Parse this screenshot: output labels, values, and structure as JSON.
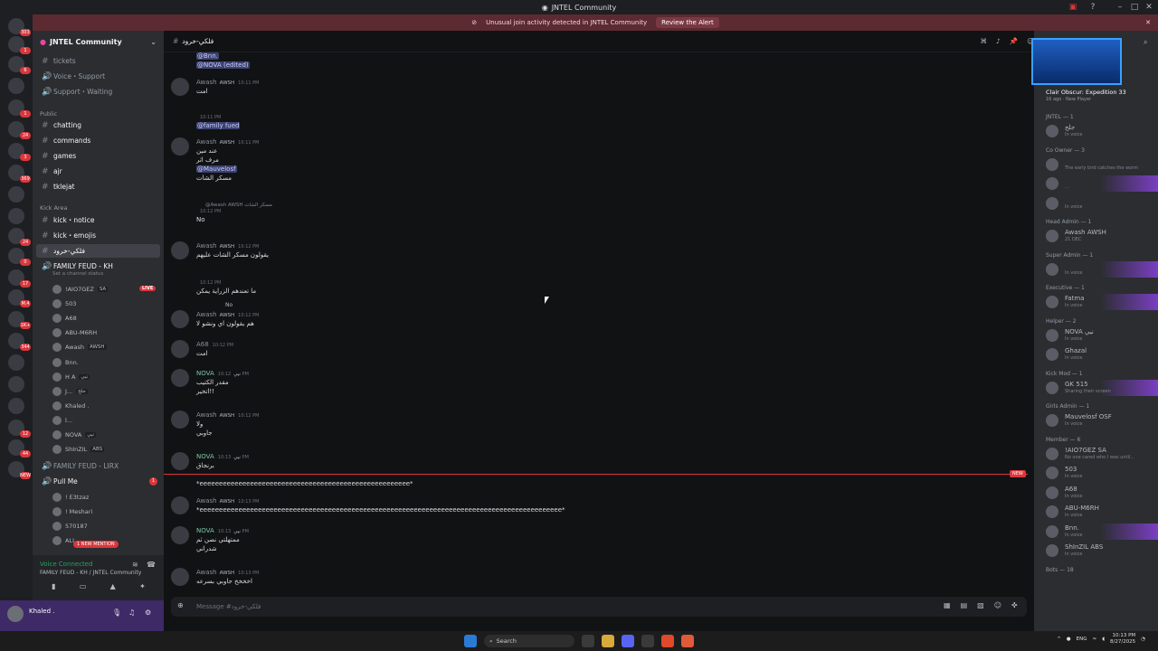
{
  "title": "JNTEL Community",
  "alert": {
    "text": "Unusual join activity detected in JNTEL Community",
    "button": "Review the Alert"
  },
  "servers": [
    {
      "badge": "303"
    },
    {
      "badge": "1"
    },
    {
      "badge": "6"
    },
    {
      "badge": ""
    },
    {
      "badge": "1"
    },
    {
      "badge": "24"
    },
    {
      "badge": "3"
    },
    {
      "badge": "369"
    },
    {
      "badge": ""
    },
    {
      "badge": ""
    },
    {
      "badge": "24"
    },
    {
      "badge": "0"
    },
    {
      "badge": "17"
    },
    {
      "badge": "M.4"
    },
    {
      "badge": "1K+"
    },
    {
      "badge": "344"
    },
    {
      "badge": ""
    },
    {
      "badge": ""
    },
    {
      "badge": ""
    },
    {
      "badge": "12"
    },
    {
      "badge": "44"
    },
    {
      "badge": "NEW"
    }
  ],
  "sidebar": {
    "server_name": "JNTEL Community",
    "top_channels": [
      "tickets",
      "Voice・Support",
      "Support・Waiting"
    ],
    "cat_public": "Public",
    "public_channels": [
      "chatting",
      "commands",
      "games",
      "ajr",
      "tklejat"
    ],
    "cat_kick": "Kick Area",
    "kick_channels": [
      "kick・notice",
      "kick・emojis"
    ],
    "active_channel": "فلكي-خرود",
    "voice_channel": "FAMILY FEUD - KH",
    "voice_status": "Set a channel status",
    "voice_users": [
      {
        "name": "!AIO7GEZ",
        "tag": "SA",
        "live": "LIVE"
      },
      {
        "name": "503",
        "tag": "",
        "live": ""
      },
      {
        "name": "A68",
        "tag": "",
        "live": ""
      },
      {
        "name": "ABU-M6RH",
        "tag": "",
        "live": ""
      },
      {
        "name": "Awash",
        "tag": "AWSH",
        "live": ""
      },
      {
        "name": "Bnn.",
        "tag": "",
        "live": ""
      },
      {
        "name": "H A",
        "tag": "نيي",
        "live": ""
      },
      {
        "name": "J...",
        "tag": "جلح",
        "live": ""
      },
      {
        "name": "Khaled .",
        "tag": "",
        "live": ""
      },
      {
        "name": "l...",
        "tag": "",
        "live": ""
      },
      {
        "name": "NOVA",
        "tag": "نيي",
        "live": ""
      },
      {
        "name": "ShInZIL",
        "tag": "ABS",
        "live": ""
      }
    ],
    "voice_channel2": "FAMILY FEUD - LIRX",
    "pull_channel": "Pull Me",
    "pull_badge": "1",
    "pull_users": [
      "! E3tzaz",
      "! Meshari",
      "570187",
      "ALI"
    ],
    "new_mention": "1 NEW MENTION",
    "voice_connected": "Voice Connected",
    "voice_connected_sub": "FAMILY FEUD - KH / JNTEL Community",
    "user_name": "Khaled ."
  },
  "chat": {
    "channel": "فلكي-خرود",
    "messages": [
      {
        "name": "",
        "role": "",
        "time": "",
        "lines": [
          "@Bnn.",
          "@NOVA (edited)"
        ]
      },
      {
        "name": "Awash",
        "role": "AWSH",
        "time": "10:11 PM",
        "lines": [
          "امت"
        ]
      },
      {
        "name": "",
        "role": "",
        "time": "10:11 PM",
        "lines": [
          "@family fued"
        ]
      },
      {
        "name": "Awash",
        "role": "AWSH",
        "time": "10:11 PM",
        "lines": [
          "عند مين",
          "مرف اثر",
          "@Mauvelosf",
          "مسكر الشات"
        ]
      },
      {
        "name": "",
        "role": "",
        "time": "10:12 PM",
        "lines": [
          "No"
        ]
      },
      {
        "name": "Awash",
        "role": "AWSH",
        "time": "10:12 PM",
        "lines": [
          "يقولون مسكر الشات عليهم"
        ]
      },
      {
        "name": "",
        "role": "",
        "time": "10:12 PM",
        "lines": [
          "ما تعندهم الزراية يمكن"
        ]
      },
      {
        "name": "Awash",
        "role": "AWSH",
        "time": "10:12 PM",
        "lines": [
          "هم يقولون اي ونشو لا"
        ]
      },
      {
        "name": "A68",
        "role": "",
        "time": "10:12 PM",
        "lines": [
          "امت"
        ]
      },
      {
        "name": "NOVA",
        "role": "نيي",
        "time": "10:12 PM",
        "lines": [
          "مقدر الكتيب",
          "اتخير!!"
        ]
      },
      {
        "name": "Awash",
        "role": "AWSH",
        "time": "10:12 PM",
        "lines": [
          "ولا",
          "جاوبي"
        ]
      },
      {
        "name": "NOVA",
        "role": "نيي",
        "time": "10:13 PM",
        "lines": [
          "برنجاق"
        ]
      },
      {
        "name": "",
        "role": "",
        "time": "",
        "lines": [
          "*eeeeeeeeeeeeeeeeeeeeeeeeeeeeeeeeeeeeeeeeeeeeeeeeeeeeee*"
        ]
      },
      {
        "name": "Awash",
        "role": "AWSH",
        "time": "10:13 PM",
        "lines": [
          "*eeeeeeeeeeeeeeeeeeeeeeeeeeeeeeeeeeeeeeeeeeeeeeeeeeeeeeeeeeeeeeeeeeeeeeeeeeeeeeeeeeeeeeeeeeeee*"
        ]
      },
      {
        "name": "NOVA",
        "role": "نيي",
        "time": "10:13 PM",
        "lines": [
          "ممتهلتي نصن ثم",
          "شدراني"
        ]
      },
      {
        "name": "Awash",
        "role": "AWSH",
        "time": "10:13 PM",
        "lines": [
          "اخخخخ جاوبي بسرعه"
        ]
      }
    ],
    "reply_preview": "@Awash AWSH مسكر الشات",
    "reply_preview2": "No",
    "new_label": "NEW",
    "composer_placeholder": "Message #فلكي-خرود"
  },
  "members": {
    "game_title": "Clair Obscur: Expedition 33",
    "game_sub": "16 ago · New Player",
    "groups": [
      {
        "label": "JNTEL — 1",
        "items": [
          {
            "name": "جلح",
            "status": "In voice",
            "banner": false
          }
        ]
      },
      {
        "label": "Co Owner — 3",
        "items": [
          {
            "name": "",
            "status": "The early bird catches the worm",
            "banner": false
          },
          {
            "name": "",
            "status": "...",
            "banner": true
          },
          {
            "name": "",
            "status": "In voice",
            "banner": false
          }
        ]
      },
      {
        "label": "Head Admin — 1",
        "items": [
          {
            "name": "Awash AWSH",
            "status": "21 DEC",
            "banner": false
          }
        ]
      },
      {
        "label": "Super Admin — 1",
        "items": [
          {
            "name": "",
            "status": "In voice",
            "banner": true
          }
        ]
      },
      {
        "label": "Executive — 1",
        "items": [
          {
            "name": "Fatma",
            "status": "In voice",
            "banner": true
          }
        ]
      },
      {
        "label": "Helper — 2",
        "items": [
          {
            "name": "NOVA نيي",
            "status": "In voice",
            "banner": false
          },
          {
            "name": "Ghazal",
            "status": "In voice",
            "banner": false
          }
        ]
      },
      {
        "label": "Kick Mod — 1",
        "items": [
          {
            "name": "GK 515",
            "status": "Sharing their screen",
            "banner": true
          }
        ]
      },
      {
        "label": "Girls Admin — 1",
        "items": [
          {
            "name": "Mauvelosf OSF",
            "status": "In voice",
            "banner": false
          }
        ]
      },
      {
        "label": "Member — 6",
        "items": [
          {
            "name": "!AIO7GEZ SA",
            "status": "No one cared who I was until...",
            "banner": false
          },
          {
            "name": "503",
            "status": "In voice",
            "banner": false
          },
          {
            "name": "A68",
            "status": "In voice",
            "banner": false
          },
          {
            "name": "ABU-M6RH",
            "status": "In voice",
            "banner": false
          },
          {
            "name": "Bnn.",
            "status": "In voice",
            "banner": true
          },
          {
            "name": "ShInZIL ABS",
            "status": "In voice",
            "banner": false
          }
        ]
      },
      {
        "label": "Bots — 18",
        "items": []
      }
    ]
  },
  "taskbar": {
    "search": "Search",
    "lang": "ENG",
    "time": "10:13 PM",
    "date": "8/27/2025"
  }
}
